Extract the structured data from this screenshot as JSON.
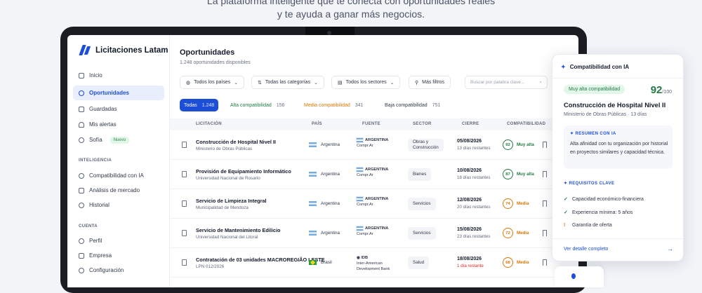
{
  "hero": {
    "line1": "La plataforma inteligente que te conecta con oportunidades reales",
    "line2": "y te ayuda a ganar más negocios."
  },
  "app": {
    "name": "Licitaciones Latam"
  },
  "sidebar": {
    "items": [
      {
        "label": "Inicio",
        "icon": "home-icon"
      },
      {
        "label": "Oportunidades",
        "icon": "target-icon",
        "active": true
      },
      {
        "label": "Guardadas",
        "icon": "bookmark-icon"
      },
      {
        "label": "Mis alertas",
        "icon": "bell-icon"
      },
      {
        "label": "Sofía",
        "icon": "sparkle-icon",
        "badge": "Nuevo"
      }
    ],
    "section_intel": "INTELIGENCIA",
    "intel_items": [
      {
        "label": "Compatibilidad con IA",
        "icon": "ai-icon"
      },
      {
        "label": "Análisis de mercado",
        "icon": "chart-icon"
      },
      {
        "label": "Historial",
        "icon": "history-icon"
      }
    ],
    "section_account": "CUENTA",
    "account_items": [
      {
        "label": "Perfil",
        "icon": "user-icon"
      },
      {
        "label": "Empresa",
        "icon": "building-icon"
      },
      {
        "label": "Configuración",
        "icon": "gear-icon"
      }
    ]
  },
  "main": {
    "title": "Oportunidades",
    "subtitle": "1.248 oportunidades disponibles",
    "filters": [
      "Todos los países",
      "Todas las categorías",
      "Todos los sectores",
      "Más filtros"
    ],
    "search_placeholder": "Buscar por palabra clave...",
    "tabs": [
      {
        "label": "Todas",
        "count": "1.248"
      },
      {
        "label": "Alta compatibilidad",
        "count": "156",
        "color": "#237a45"
      },
      {
        "label": "Media compatibilidad",
        "count": "341",
        "color": "#d97706"
      },
      {
        "label": "Baja compatibilidad",
        "count": "751",
        "color": "#333a4a"
      }
    ],
    "columns": [
      "LICITACIÓN",
      "PAÍS",
      "FUENTE",
      "SECTOR",
      "CIERRE",
      "COMPATIBILIDAD"
    ],
    "rows": [
      {
        "name": "Construcción de Hospital Nivel II",
        "org": "Ministerio de Obras Públicas",
        "country": "Argentina",
        "source": "ARGENTINA",
        "source_sub": "Compr.Ar",
        "sector": "Obras y\nConstrucción",
        "date": "05/08/2026",
        "days": "13 días restantes",
        "score": "92",
        "level": "Muy alta",
        "color": "#237a45"
      },
      {
        "name": "Provisión de Equipamiento Informático",
        "org": "Universidad Nacional de Rosario",
        "country": "Argentina",
        "source": "ARGENTINA",
        "source_sub": "Compr.Ar",
        "sector": "Bienes",
        "date": "10/08/2026",
        "days": "18 días restantes",
        "score": "87",
        "level": "Muy alta",
        "color": "#237a45"
      },
      {
        "name": "Servicio de Limpieza Integral",
        "org": "Municipalidad de Mendoza",
        "country": "Argentina",
        "source": "ARGENTINA",
        "source_sub": "Compr.Ar",
        "sector": "Servicios",
        "date": "12/08/2026",
        "days": "20 días restantes",
        "score": "74",
        "level": "Media",
        "color": "#d97706"
      },
      {
        "name": "Servicio de Mantenimiento Edilicio",
        "org": "Universidad Nacional del Litoral",
        "country": "Argentina",
        "source": "ARGENTINA",
        "source_sub": "Compr.Ar",
        "sector": "Servicios",
        "date": "15/08/2026",
        "days": "23 días restantes",
        "score": "72",
        "level": "Media",
        "color": "#d97706"
      },
      {
        "name": "Contratación de 03 unidades MACROREGIÃO LESTE",
        "org": "LPN 012/2026",
        "country": "Brasil",
        "source": "IDB",
        "source_sub": "Inter-American\nDevelopment Bank",
        "sector": "Salud",
        "date": "18/08/2026",
        "days": "1 día restante",
        "score": "68",
        "level": "Media",
        "color": "#d97706"
      }
    ]
  },
  "panel": {
    "title": "Compatibilidad con IA",
    "badge": "Muy alta compatibilidad",
    "score": "92",
    "score_max": "/100",
    "project": "Construcción de Hospital Nivel II",
    "org": "Ministerio de Obras Públicas · 13 días",
    "summary_title": "✦ RESUMEN CON IA",
    "summary": "Alta afinidad con tu organización por historial en proyectos similares y capacidad técnica.",
    "req_title": "✦ REQUISITOS CLAVE",
    "requirements": [
      {
        "mark": "✓",
        "label": "Capacidad económico-financiera",
        "color": "#237a45"
      },
      {
        "mark": "✓",
        "label": "Experiencia mínima: 5 años",
        "color": "#237a45"
      },
      {
        "mark": "!",
        "label": "Garantía de oferta",
        "color": "#d97706"
      }
    ],
    "link": "Ver detalle completo",
    "arrow": "→"
  }
}
